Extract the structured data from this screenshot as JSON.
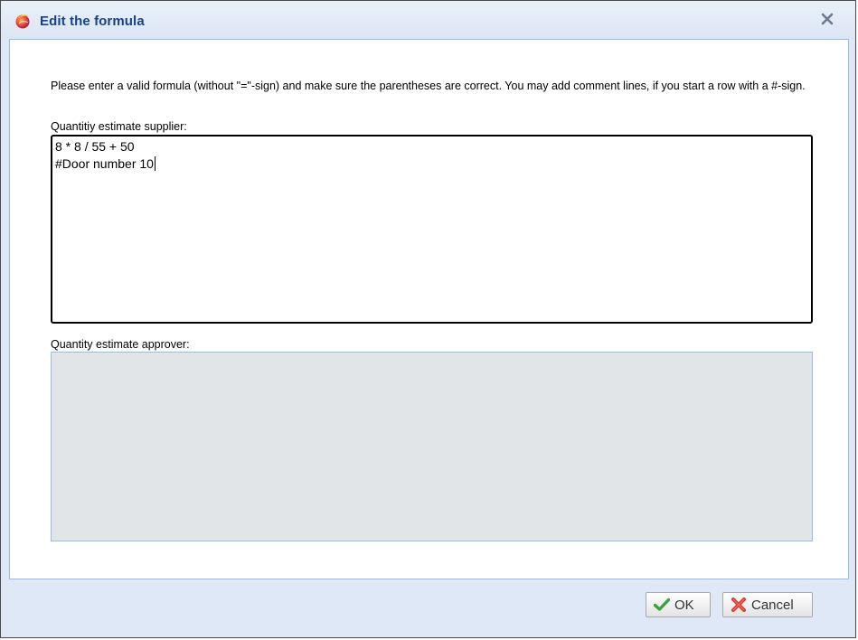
{
  "dialog": {
    "title": "Edit the formula",
    "instructions": "Please enter a valid formula (without \"=\"-sign) and make sure the parentheses are correct. You may add comment lines, if you start a row with a #-sign.",
    "supplier": {
      "label": "Quantitiy estimate supplier:",
      "lines": [
        "8 * 8 / 55 + 50",
        "#Door number 10"
      ]
    },
    "approver": {
      "label": "Quantity estimate approver:",
      "value": ""
    },
    "buttons": {
      "ok_label": "OK",
      "cancel_label": "Cancel"
    }
  },
  "icons": {
    "app": "app-logo-icon",
    "close": "close-icon",
    "ok": "checkmark-icon",
    "cancel": "x-cancel-icon"
  },
  "colors": {
    "title_text": "#15428b",
    "frame": "#dfe8f6",
    "panel_border": "#99bbe8",
    "disabled_field": "#e1e5e8",
    "ok_icon": "#3aa335",
    "cancel_icon": "#d9342b"
  }
}
